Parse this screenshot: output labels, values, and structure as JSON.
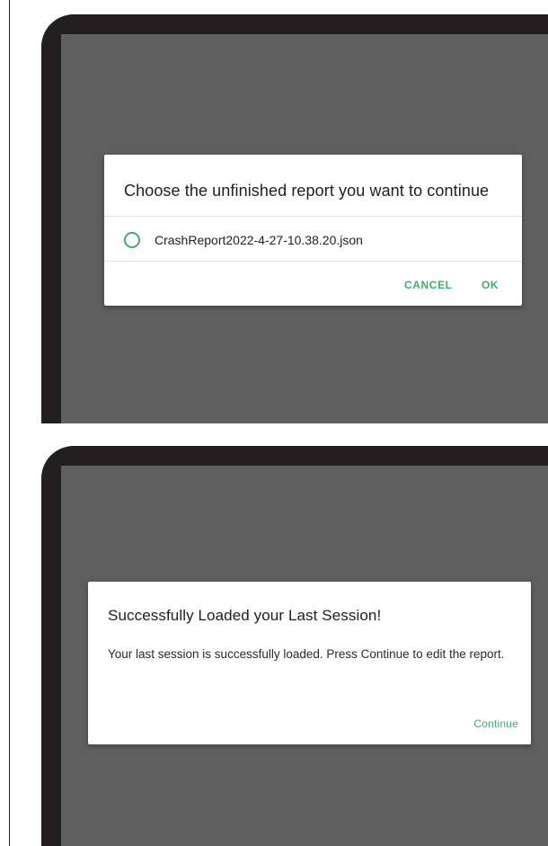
{
  "dialog1": {
    "title": "Choose the unfinished report you want to continue",
    "options": [
      {
        "label": "CrashReport2022-4-27-10.38.20.json",
        "selected": false
      }
    ],
    "buttons": {
      "cancel": "CANCEL",
      "ok": "OK"
    }
  },
  "dialog2": {
    "title": "Successfully Loaded your Last Session!",
    "message": "Your last session is successfully loaded. Press Continue to edit the report.",
    "buttons": {
      "continue": "Continue"
    }
  },
  "colors": {
    "accent": "#3fae6b",
    "screen_bg": "#5f5f5f",
    "device_bezel": "#231f20",
    "dialog_bg": "#ffffff"
  }
}
